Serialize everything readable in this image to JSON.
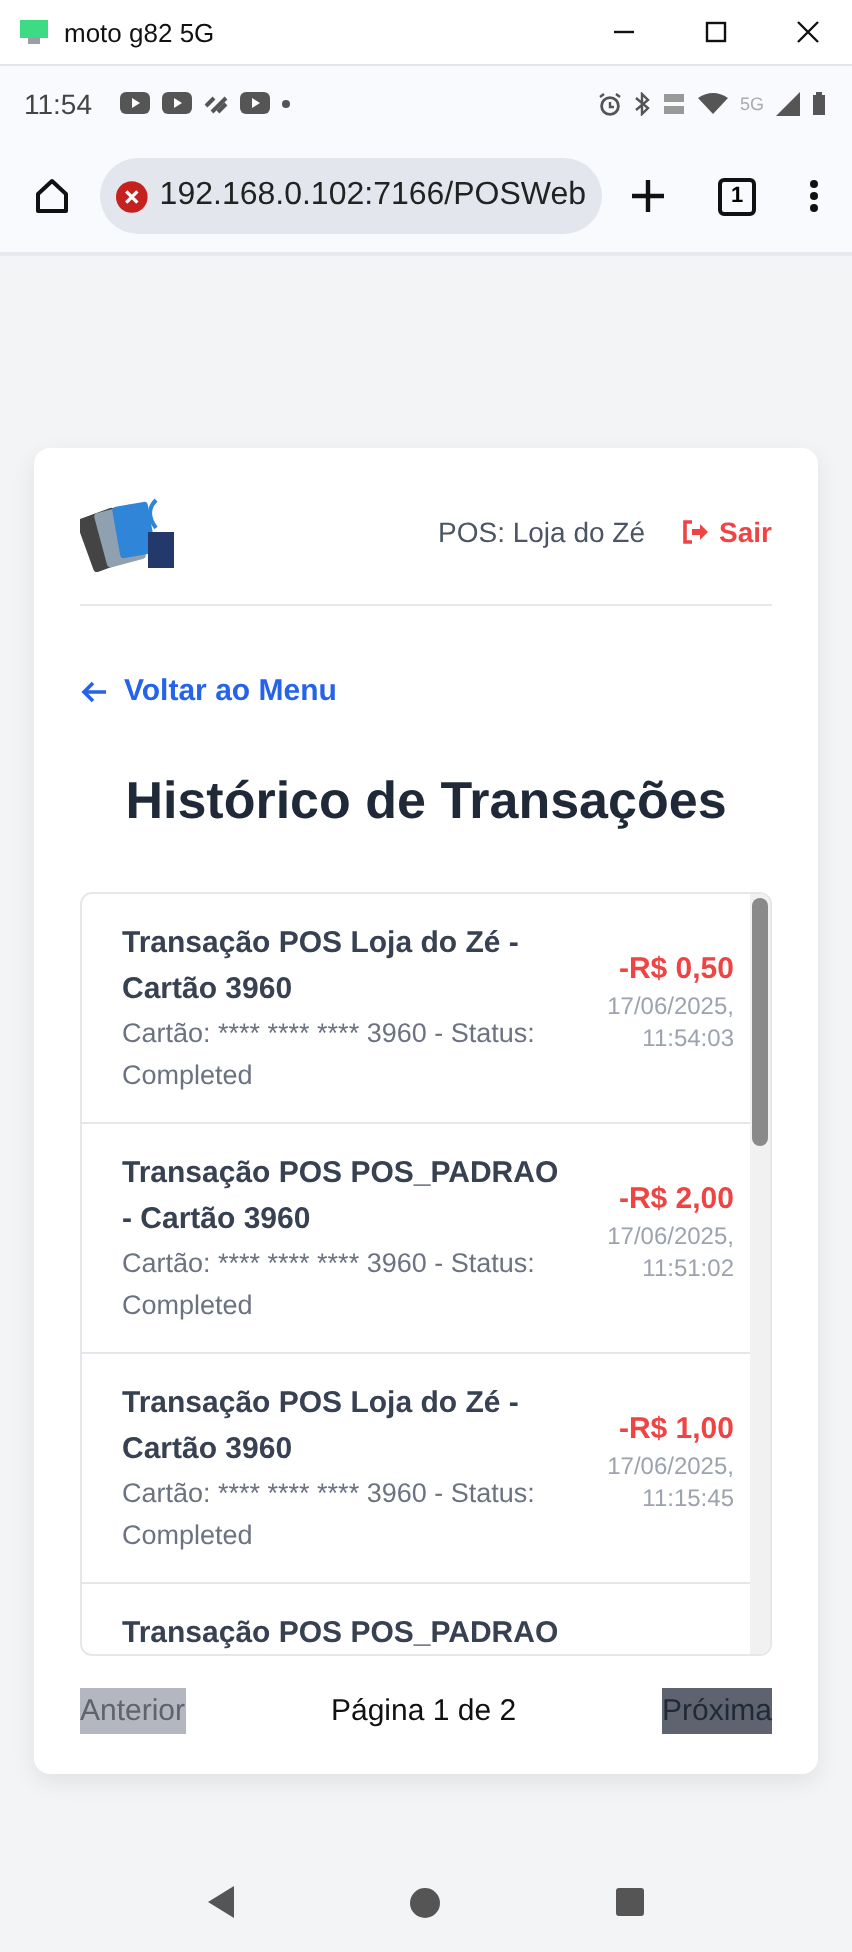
{
  "window": {
    "title": "moto g82 5G"
  },
  "status_bar": {
    "time": "11:54",
    "network": "5G"
  },
  "browser": {
    "url": "192.168.0.102:7166/POSWeb",
    "secure": false,
    "tab_count": "1"
  },
  "header": {
    "pos_label": "POS: Loja do Zé",
    "logout": "Sair"
  },
  "back_link": "Voltar ao Menu",
  "title": "Histórico de Transações",
  "transactions": [
    {
      "title": "Transação POS Loja do Zé - Cartão 3960",
      "detail": "Cartão: **** **** **** 3960 - Status: Completed",
      "amount": "-R$ 0,50",
      "date": "17/06/2025,",
      "time": "11:54:03"
    },
    {
      "title": "Transação POS POS_PADRAO - Cartão 3960",
      "detail": "Cartão: **** **** **** 3960 - Status: Completed",
      "amount": "-R$ 2,00",
      "date": "17/06/2025,",
      "time": "11:51:02"
    },
    {
      "title": "Transação POS Loja do Zé - Cartão 3960",
      "detail": "Cartão: **** **** **** 3960 - Status: Completed",
      "amount": "-R$ 1,00",
      "date": "17/06/2025,",
      "time": "11:15:45"
    },
    {
      "title": "Transação POS POS_PADRAO"
    }
  ],
  "pagination": {
    "previous": {
      "label": "Anterior",
      "disabled": true
    },
    "page_label": "Página 1 de 2",
    "next": {
      "label": "Próxima",
      "disabled": false
    }
  }
}
